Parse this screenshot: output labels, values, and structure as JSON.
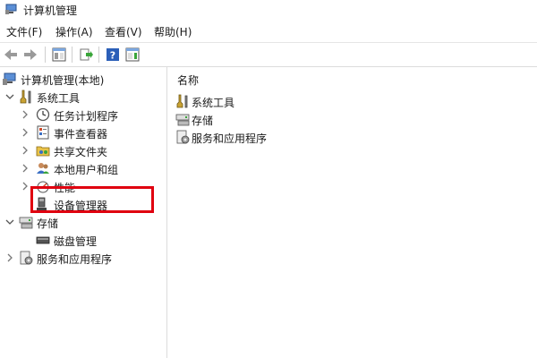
{
  "window": {
    "title": "计算机管理"
  },
  "menu": {
    "file": "文件(F)",
    "action": "操作(A)",
    "view": "查看(V)",
    "help": "帮助(H)"
  },
  "tree": {
    "root": "计算机管理(本地)",
    "system_tools": "系统工具",
    "task_scheduler": "任务计划程序",
    "event_viewer": "事件查看器",
    "shared_folders": "共享文件夹",
    "local_users": "本地用户和组",
    "performance": "性能",
    "device_manager": "设备管理器",
    "storage": "存储",
    "disk_management": "磁盘管理",
    "services": "服务和应用程序"
  },
  "list": {
    "header": "名称",
    "items": [
      "系统工具",
      "存储",
      "服务和应用程序"
    ]
  },
  "colors": {
    "highlight": "#e0000f"
  }
}
